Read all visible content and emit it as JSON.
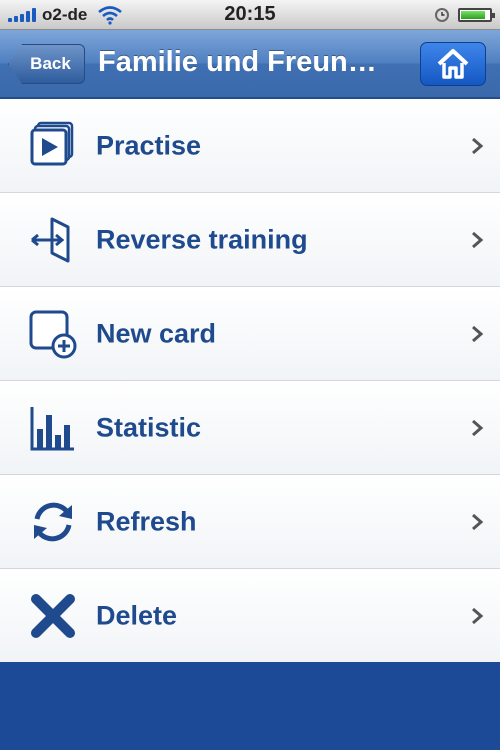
{
  "status_bar": {
    "carrier": "o2-de",
    "time": "20:15",
    "battery_level": 0.85
  },
  "nav": {
    "back_label": "Back",
    "title": "Familie und Freun…",
    "home_icon": "home-icon"
  },
  "menu": {
    "items": [
      {
        "label": "Practise",
        "icon": "practise-icon"
      },
      {
        "label": "Reverse training",
        "icon": "reverse-training-icon"
      },
      {
        "label": "New card",
        "icon": "new-card-icon"
      },
      {
        "label": "Statistic",
        "icon": "statistic-icon"
      },
      {
        "label": "Refresh",
        "icon": "refresh-icon"
      },
      {
        "label": "Delete",
        "icon": "delete-icon"
      }
    ]
  },
  "colors": {
    "accent": "#1f4a8d",
    "navbar": "#4f7fc0",
    "footer": "#1d4a96"
  }
}
